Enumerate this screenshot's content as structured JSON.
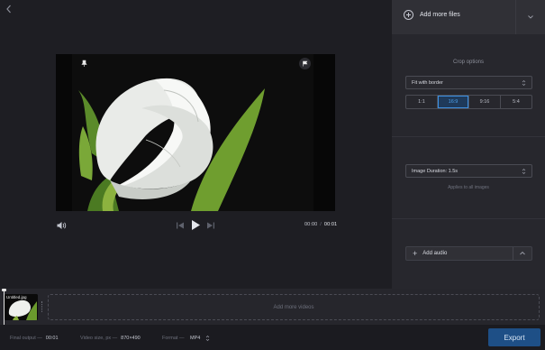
{
  "colors": {
    "accent": "#3d8fe0",
    "export_bg": "#1e4f86",
    "panel_bg": "#27272d",
    "editor_bg": "#1e1e23"
  },
  "icons": {
    "back": "chevron-left-icon",
    "pin": "pin-icon",
    "flag": "flag-icon",
    "volume": "volume-icon",
    "prev": "skip-back-icon",
    "play": "play-icon",
    "next": "skip-forward-icon",
    "add": "plus-circle-icon",
    "collapse": "chevron-down-icon",
    "expand": "chevron-up-icon"
  },
  "player": {
    "current_time": "00:00",
    "separator": "/",
    "total_time": "00:01"
  },
  "panel": {
    "add_files_label": "Add more files",
    "crop_title": "Crop options",
    "crop_mode": "Fit with border",
    "ratios": [
      {
        "label": "1:1",
        "active": false
      },
      {
        "label": "16:9",
        "active": true
      },
      {
        "label": "9:16",
        "active": false
      },
      {
        "label": "5:4",
        "active": false
      }
    ],
    "image_duration": "Image Duration: 1.5s",
    "applies_note": "Applies to all images",
    "add_audio_label": "Add audio"
  },
  "timeline": {
    "clip_label": "Untitled.jpg",
    "add_videos_label": "Add more videos"
  },
  "bottom": {
    "final_output_label": "Final output —",
    "final_output_value": "00:01",
    "video_size_label": "Video size, px —",
    "video_size_value": "870×490",
    "format_label": "Format —",
    "format_value": "MP4",
    "export_label": "Export"
  }
}
